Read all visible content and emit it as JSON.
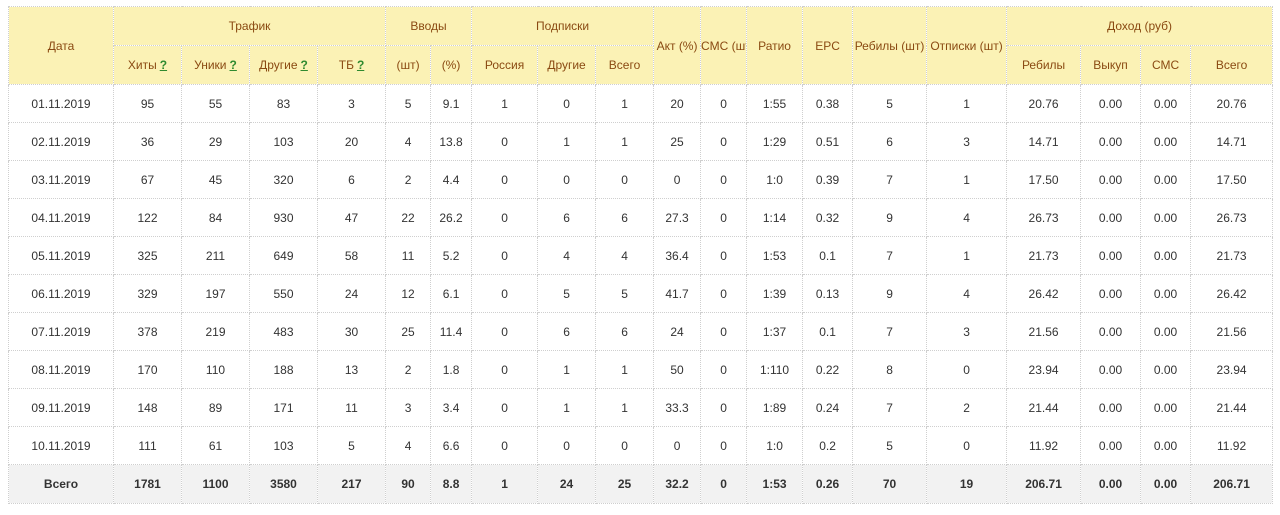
{
  "headers": {
    "date": "Дата",
    "traffic": "Трафик",
    "inputs": "Вводы",
    "subscriptions": "Подписки",
    "act": "Акт (%)",
    "sms": "СМС (шт)",
    "ratio": "Ратио",
    "epc": "EPC",
    "rebills": "Ребилы (шт)",
    "unsubs": "Отписки (шт)",
    "income": "Доход (руб)",
    "hits": "Хиты",
    "uniques": "Уники",
    "others": "Другие",
    "tb": "ТБ",
    "inputs_pcs": "(шт)",
    "inputs_pct": "(%)",
    "russia": "Россия",
    "sub_others": "Другие",
    "sub_total": "Всего",
    "inc_rebills": "Ребилы",
    "inc_buyout": "Выкуп",
    "inc_sms": "СМС",
    "inc_total": "Всего",
    "hint": "?"
  },
  "rows": [
    [
      "01.11.2019",
      "95",
      "55",
      "83",
      "3",
      "5",
      "9.1",
      "1",
      "0",
      "1",
      "20",
      "0",
      "1:55",
      "0.38",
      "5",
      "1",
      "20.76",
      "0.00",
      "0.00",
      "20.76"
    ],
    [
      "02.11.2019",
      "36",
      "29",
      "103",
      "20",
      "4",
      "13.8",
      "0",
      "1",
      "1",
      "25",
      "0",
      "1:29",
      "0.51",
      "6",
      "3",
      "14.71",
      "0.00",
      "0.00",
      "14.71"
    ],
    [
      "03.11.2019",
      "67",
      "45",
      "320",
      "6",
      "2",
      "4.4",
      "0",
      "0",
      "0",
      "0",
      "0",
      "1:0",
      "0.39",
      "7",
      "1",
      "17.50",
      "0.00",
      "0.00",
      "17.50"
    ],
    [
      "04.11.2019",
      "122",
      "84",
      "930",
      "47",
      "22",
      "26.2",
      "0",
      "6",
      "6",
      "27.3",
      "0",
      "1:14",
      "0.32",
      "9",
      "4",
      "26.73",
      "0.00",
      "0.00",
      "26.73"
    ],
    [
      "05.11.2019",
      "325",
      "211",
      "649",
      "58",
      "11",
      "5.2",
      "0",
      "4",
      "4",
      "36.4",
      "0",
      "1:53",
      "0.1",
      "7",
      "1",
      "21.73",
      "0.00",
      "0.00",
      "21.73"
    ],
    [
      "06.11.2019",
      "329",
      "197",
      "550",
      "24",
      "12",
      "6.1",
      "0",
      "5",
      "5",
      "41.7",
      "0",
      "1:39",
      "0.13",
      "9",
      "4",
      "26.42",
      "0.00",
      "0.00",
      "26.42"
    ],
    [
      "07.11.2019",
      "378",
      "219",
      "483",
      "30",
      "25",
      "11.4",
      "0",
      "6",
      "6",
      "24",
      "0",
      "1:37",
      "0.1",
      "7",
      "3",
      "21.56",
      "0.00",
      "0.00",
      "21.56"
    ],
    [
      "08.11.2019",
      "170",
      "110",
      "188",
      "13",
      "2",
      "1.8",
      "0",
      "1",
      "1",
      "50",
      "0",
      "1:110",
      "0.22",
      "8",
      "0",
      "23.94",
      "0.00",
      "0.00",
      "23.94"
    ],
    [
      "09.11.2019",
      "148",
      "89",
      "171",
      "11",
      "3",
      "3.4",
      "0",
      "1",
      "1",
      "33.3",
      "0",
      "1:89",
      "0.24",
      "7",
      "2",
      "21.44",
      "0.00",
      "0.00",
      "21.44"
    ],
    [
      "10.11.2019",
      "111",
      "61",
      "103",
      "5",
      "4",
      "6.6",
      "0",
      "0",
      "0",
      "0",
      "0",
      "1:0",
      "0.2",
      "5",
      "0",
      "11.92",
      "0.00",
      "0.00",
      "11.92"
    ]
  ],
  "totals": [
    "Всего",
    "1781",
    "1100",
    "3580",
    "217",
    "90",
    "8.8",
    "1",
    "24",
    "25",
    "32.2",
    "0",
    "1:53",
    "0.26",
    "70",
    "19",
    "206.71",
    "0.00",
    "0.00",
    "206.71"
  ]
}
